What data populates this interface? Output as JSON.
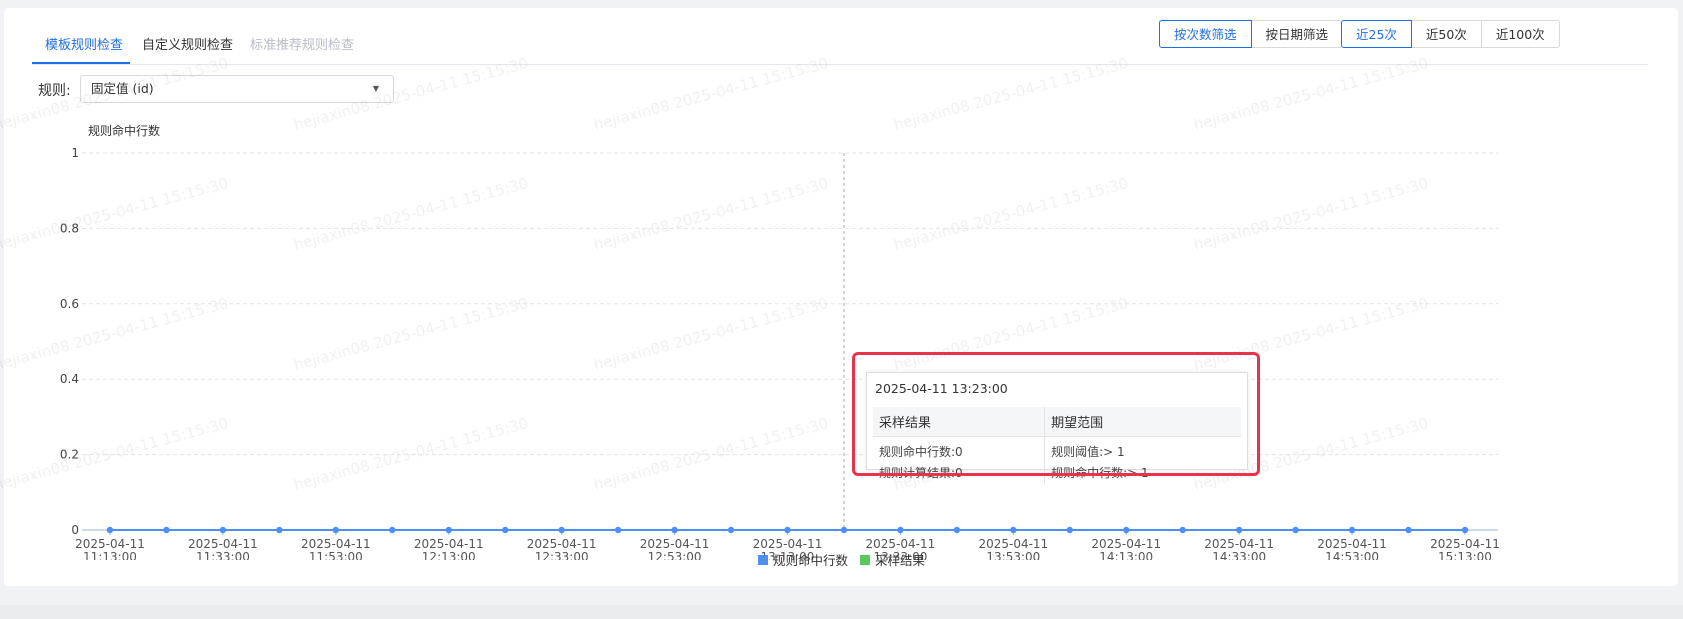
{
  "tabs": [
    {
      "label": "模板规则检查",
      "state": "active"
    },
    {
      "label": "自定义规则检查",
      "state": "normal"
    },
    {
      "label": "标准推荐规则检查",
      "state": "disabled"
    }
  ],
  "filter_mode": {
    "by_count": "按次数筛选",
    "by_date": "按日期筛选",
    "selected": "by_count"
  },
  "range_buttons": {
    "last25": "近25次",
    "last50": "近50次",
    "last100": "近100次",
    "selected": "last25"
  },
  "rule": {
    "label": "规则:",
    "value": "固定值 (id)"
  },
  "watermark_text": "hejiaxin08 2025-04-11 15:15:30",
  "colors": {
    "accent": "#1f6fe5",
    "series_hits": "#4e8ef7",
    "series_sample": "#58c95b",
    "highlight": "#e8334a"
  },
  "chart_data": {
    "type": "line",
    "ylabel": "规则命中行数",
    "ylim": [
      0,
      1
    ],
    "yticks": [
      "1",
      "0.8",
      "0.6",
      "0.4",
      "0.2",
      "0"
    ],
    "x": [
      "2025-04-11 11:13:00",
      "2025-04-11 11:23:00",
      "2025-04-11 11:33:00",
      "2025-04-11 11:43:00",
      "2025-04-11 11:53:00",
      "2025-04-11 12:03:00",
      "2025-04-11 12:13:00",
      "2025-04-11 12:23:00",
      "2025-04-11 12:33:00",
      "2025-04-11 12:43:00",
      "2025-04-11 12:53:00",
      "2025-04-11 13:03:00",
      "2025-04-11 13:13:00",
      "2025-04-11 13:23:00",
      "2025-04-11 13:33:00",
      "2025-04-11 13:43:00",
      "2025-04-11 13:53:00",
      "2025-04-11 14:03:00",
      "2025-04-11 14:13:00",
      "2025-04-11 14:23:00",
      "2025-04-11 14:33:00",
      "2025-04-11 14:43:00",
      "2025-04-11 14:53:00",
      "2025-04-11 15:03:00",
      "2025-04-11 15:13:00"
    ],
    "xtick_labels": [
      {
        "date": "2025-04-11",
        "time": "11:13:00"
      },
      {
        "date": "2025-04-11",
        "time": "11:33:00"
      },
      {
        "date": "2025-04-11",
        "time": "11:53:00"
      },
      {
        "date": "2025-04-11",
        "time": "12:13:00"
      },
      {
        "date": "2025-04-11",
        "time": "12:33:00"
      },
      {
        "date": "2025-04-11",
        "time": "12:53:00"
      },
      {
        "date": "2025-04-11",
        "time": "13:13:00"
      },
      {
        "date": "2025-04-11",
        "time": "13:33:00"
      },
      {
        "date": "2025-04-11",
        "time": "13:53:00"
      },
      {
        "date": "2025-04-11",
        "time": "14:13:00"
      },
      {
        "date": "2025-04-11",
        "time": "14:33:00"
      },
      {
        "date": "2025-04-11",
        "time": "14:53:00"
      },
      {
        "date": "2025-04-11",
        "time": "15:13:00"
      }
    ],
    "series": [
      {
        "name": "规则命中行数",
        "values": [
          0,
          0,
          0,
          0,
          0,
          0,
          0,
          0,
          0,
          0,
          0,
          0,
          0,
          0,
          0,
          0,
          0,
          0,
          0,
          0,
          0,
          0,
          0,
          0,
          0
        ]
      },
      {
        "name": "采样结果",
        "values": []
      }
    ],
    "grid": true,
    "legend": "bottom",
    "hover_x": "2025-04-11 13:23:00"
  },
  "tooltip": {
    "time": "2025-04-11 13:23:00",
    "col1_header": "采样结果",
    "col2_header": "期望范围",
    "col1_rows": [
      "规则命中行数:0",
      "规则计算结果:0"
    ],
    "col2_rows": [
      "规则阈值:> 1",
      "规则命中行数:> 1"
    ]
  }
}
